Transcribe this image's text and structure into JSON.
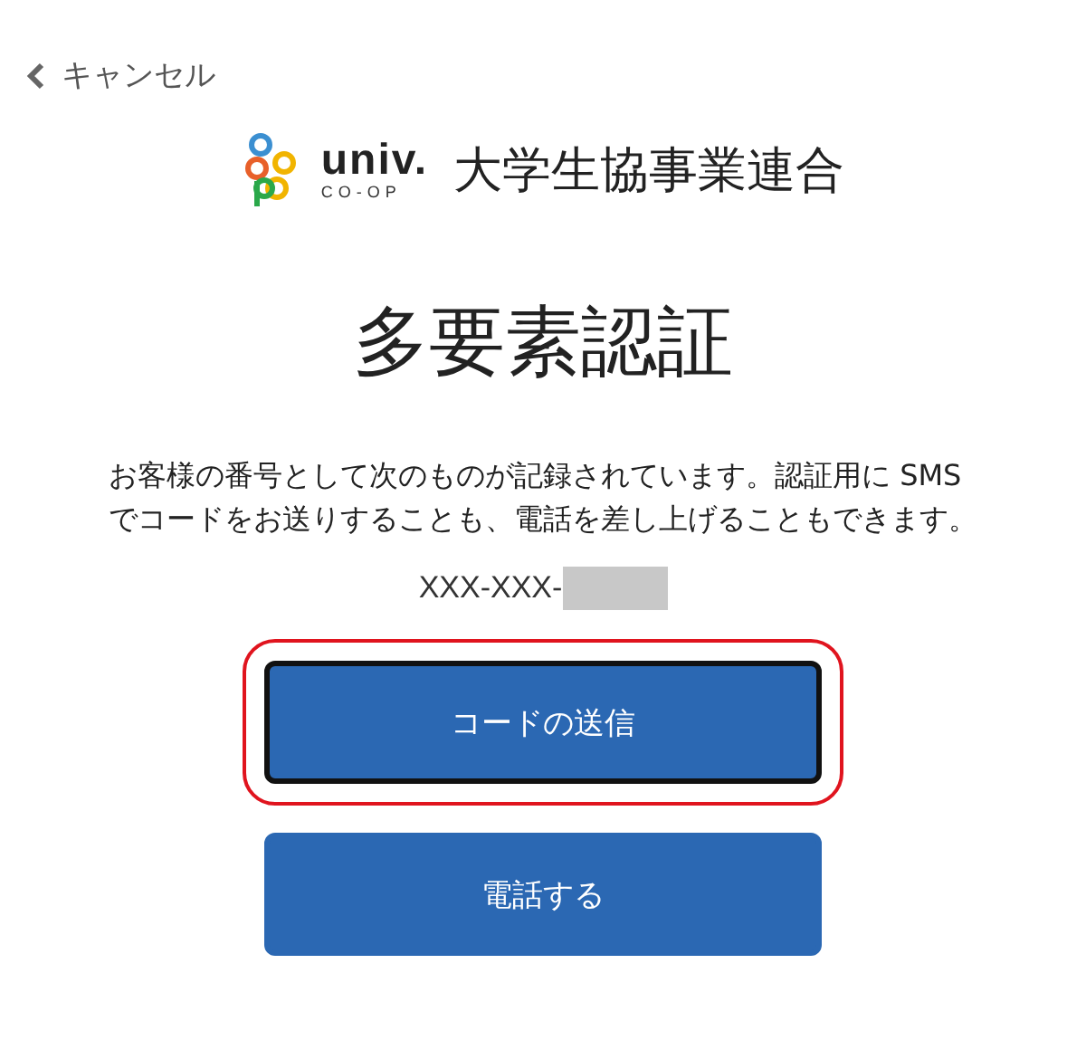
{
  "header": {
    "back_label": "キャンセル"
  },
  "logo": {
    "wordmark": "univ.",
    "subtitle": "CO-OP",
    "organization": "大学生協事業連合"
  },
  "title": "多要素認証",
  "description": "お客様の番号として次のものが記録されています。認証用に SMS でコードをお送りすることも、電話を差し上げることもできます。",
  "phone": {
    "prefix": "XXX-XXX-",
    "redacted": true
  },
  "buttons": [
    {
      "label": "コードの送信",
      "focused": true,
      "highlighted": true
    },
    {
      "label": "電話する",
      "focused": false,
      "highlighted": false
    }
  ]
}
